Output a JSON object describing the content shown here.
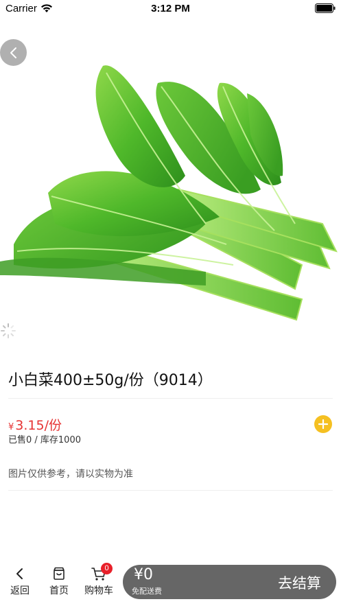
{
  "status_bar": {
    "carrier": "Carrier",
    "time": "3:12 PM"
  },
  "hero": {
    "image": "bok-choy-vegetable-photo"
  },
  "product": {
    "title": "小白菜400±50g/份（9014）",
    "price_symbol": "¥",
    "price": "3.15/份",
    "stock": "已售0 / 库存1000",
    "note": "图片仅供参考，请以实物为准"
  },
  "tabbar": {
    "back_label": "返回",
    "home_label": "首页",
    "cart_label": "购物车",
    "cart_count": "0"
  },
  "checkout": {
    "total": "¥0",
    "delivery": "免配送费",
    "label": "去结算"
  },
  "colors": {
    "price": "#e63333",
    "add_button": "#f5c021",
    "badge": "#e8202a",
    "checkout_bar": "#666666"
  }
}
